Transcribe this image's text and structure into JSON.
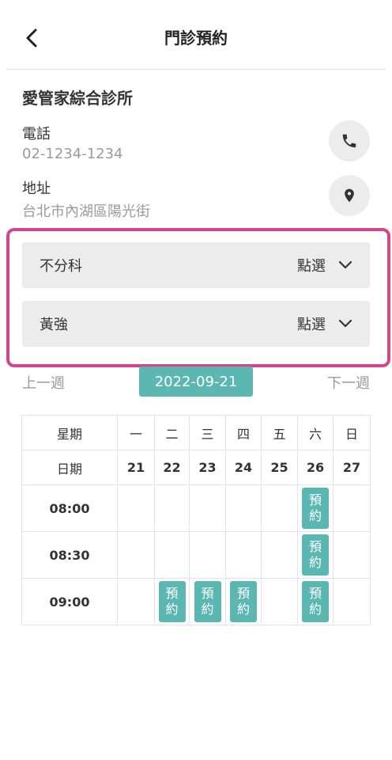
{
  "header": {
    "title": "門診預約"
  },
  "clinic": {
    "name": "愛管家綜合診所",
    "phone_label": "電話",
    "phone": "02-1234-1234",
    "address_label": "地址",
    "address": "台北市內湖區陽光街"
  },
  "selectors": [
    {
      "label": "不分科",
      "value": "點選"
    },
    {
      "label": "黃強",
      "value": "點選"
    }
  ],
  "week": {
    "prev": "上一週",
    "date": "2022-09-21",
    "next": "下一週"
  },
  "schedule": {
    "weekday_header": "星期",
    "weekdays": [
      "一",
      "二",
      "三",
      "四",
      "五",
      "六",
      "日"
    ],
    "date_header": "日期",
    "dates": [
      "21",
      "22",
      "23",
      "24",
      "25",
      "26",
      "27"
    ],
    "book_label": "預約",
    "slots": [
      {
        "time": "08:00",
        "available": [
          false,
          false,
          false,
          false,
          false,
          true,
          false
        ]
      },
      {
        "time": "08:30",
        "available": [
          false,
          false,
          false,
          false,
          false,
          true,
          false
        ]
      },
      {
        "time": "09:00",
        "available": [
          false,
          true,
          true,
          true,
          false,
          true,
          false
        ]
      }
    ]
  },
  "colors": {
    "accent": "#5bb7b2",
    "highlight": "#d6458a",
    "panel": "#ececec"
  }
}
